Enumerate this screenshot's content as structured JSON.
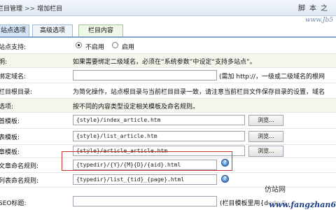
{
  "breadcrumb": {
    "parent": "栏目管理",
    "separator": ">>",
    "current": "增加栏目"
  },
  "watermark": {
    "top": "脚本之",
    "url": "www.Jb5",
    "logo_text": "仿站网",
    "bottom_url": "www.fangzhan6"
  },
  "tabs": [
    {
      "label": "站点选项"
    },
    {
      "label": "高级选项"
    },
    {
      "label": "栏目内容"
    }
  ],
  "fields": {
    "multisite": {
      "label": "站点支持:",
      "options": [
        "不启用",
        "启用"
      ],
      "selected": "不启用"
    },
    "note_row": {
      "label": "明:",
      "text": "如果需要绑定二级域名，必须在“系统参数”中设定“支持多站点”。"
    },
    "domain": {
      "label": "绑定域名:",
      "value": "",
      "hint": "(需加 http://，一级或二级域名的根网"
    },
    "rootdir": {
      "label": "栏目根目录:",
      "text": "为简化操作，站点根目录与当前栏目目录一致，请注意当前栏目文件保存目录的设置，域名"
    },
    "template_section": {
      "label": "选项:",
      "text": "按不同的内容类型设定相关模板及命名规则。"
    },
    "index_tpl": {
      "label": "首模板:",
      "value": "{style}/index_article.htm",
      "button": "浏览..."
    },
    "list_tpl": {
      "label": "表模板:",
      "value": "{style}/list_article.htm",
      "button": "浏览..."
    },
    "article_tpl": {
      "label": "章模板:",
      "value": "{style}/article_article.htm",
      "button": "浏览..."
    },
    "article_rule": {
      "label": "文章命名规则:",
      "value": "{typedir}/{Y}/{M}{D}/{aid}.html",
      "help": "?"
    },
    "list_rule": {
      "label": "列表命名规则:",
      "value": "{typedir}/list_{tid}_{page}.html",
      "help": "?"
    },
    "seo_title": {
      "label": "SEO标题:",
      "value": "",
      "hint": "(栏目模板里用{dede:fi"
    }
  }
}
